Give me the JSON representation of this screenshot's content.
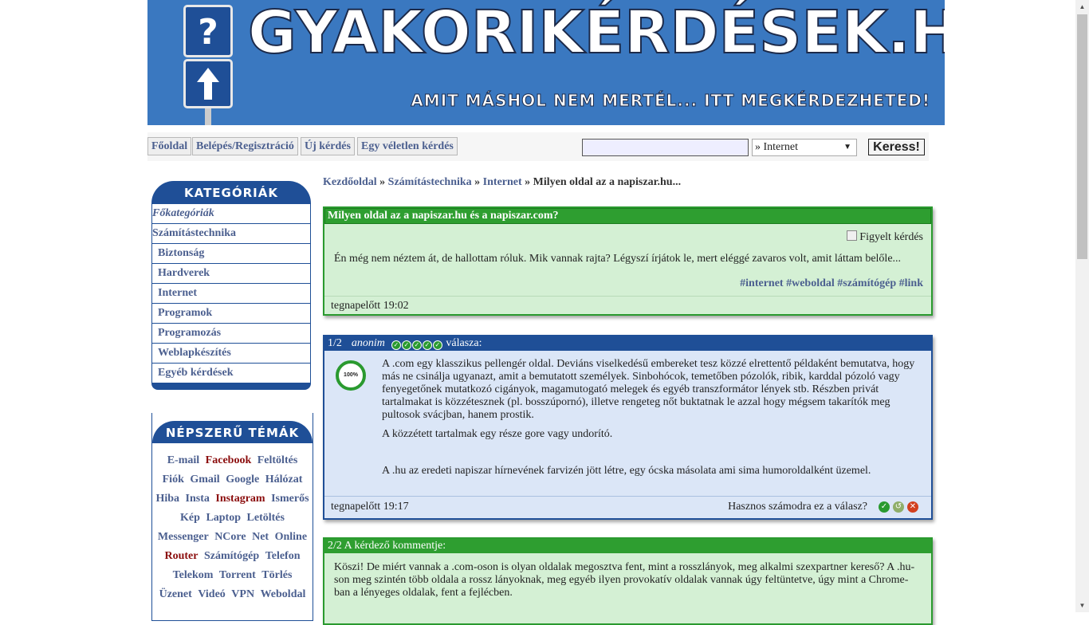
{
  "banner": {
    "title": "GYAKORIKÉRDÉSEK.HU",
    "slogan": "AMIT MÁSHOL NEM MERTÉL... ITT MEGKÉRDEZHETED!",
    "sign_question": "?",
    "sign_arrow": "↑"
  },
  "nav": {
    "home": "Főoldal",
    "login": "Belépés/Regisztráció",
    "new_question": "Új kérdés",
    "random_question": "Egy véletlen kérdés"
  },
  "search": {
    "placeholder": "",
    "category_selected": "» Internet",
    "button": "Keress!"
  },
  "categories": {
    "header": "KATEGÓRIÁK",
    "main_label": "Főkategóriák",
    "parent": "Számítástechnika",
    "items": [
      "Biztonság",
      "Hardverek",
      "Internet",
      "Programok",
      "Programozás",
      "Weblapkészítés",
      "Egyéb kérdések"
    ]
  },
  "popular": {
    "header": "NÉPSZERŰ TÉMÁK",
    "tags": [
      {
        "label": "E-mail",
        "hot": false
      },
      {
        "label": "Facebook",
        "hot": true
      },
      {
        "label": "Feltöltés",
        "hot": false
      },
      {
        "label": "Fiók",
        "hot": false
      },
      {
        "label": "Gmail",
        "hot": false
      },
      {
        "label": "Google",
        "hot": false
      },
      {
        "label": "Hálózat",
        "hot": false
      },
      {
        "label": "Hiba",
        "hot": false
      },
      {
        "label": "Insta",
        "hot": false
      },
      {
        "label": "Instagram",
        "hot": true
      },
      {
        "label": "Ismerős",
        "hot": false
      },
      {
        "label": "Kép",
        "hot": false
      },
      {
        "label": "Laptop",
        "hot": false
      },
      {
        "label": "Letöltés",
        "hot": false
      },
      {
        "label": "Messenger",
        "hot": false
      },
      {
        "label": "NCore",
        "hot": false
      },
      {
        "label": "Net",
        "hot": false
      },
      {
        "label": "Online",
        "hot": false
      },
      {
        "label": "Router",
        "hot": true
      },
      {
        "label": "Számítógép",
        "hot": false
      },
      {
        "label": "Telefon",
        "hot": false
      },
      {
        "label": "Telekom",
        "hot": false
      },
      {
        "label": "Torrent",
        "hot": false
      },
      {
        "label": "Törlés",
        "hot": false
      },
      {
        "label": "Üzenet",
        "hot": false
      },
      {
        "label": "Videó",
        "hot": false
      },
      {
        "label": "VPN",
        "hot": false
      },
      {
        "label": "Weboldal",
        "hot": false
      }
    ]
  },
  "breadcrumb": {
    "home": "Kezdőoldal",
    "sep": " » ",
    "level1": "Számítástechnika",
    "level2": "Internet",
    "current": "Milyen oldal az a napiszar.hu..."
  },
  "question": {
    "title": "Milyen oldal az a napiszar.hu és a napiszar.com?",
    "watch_label": "Figyelt kérdés",
    "body": "Én még nem néztem át, de hallottam róluk. Mik vannak rajta? Légyszí írjátok le, mert eléggé zavaros volt, amit láttam belőle...",
    "tags": "#internet #weboldal #számítógép #link",
    "time": "tegnapelőtt 19:02"
  },
  "answer1": {
    "index": "1/2",
    "user": "anonim",
    "suffix": "válasza:",
    "rating_percent": "100%",
    "paragraphs": [
      "A .com egy klasszikus pellengér oldal. Deviáns viselkedésű embereket tesz közzé elrettentő példaként bemutatva, hogy más ne csinálja ugyanazt, amit a bemutatott személyek. Sinbohócok, temetőben pózolók, ribik, karddal pózoló vagy fenyegetőnek mutatkozó cigányok, magamutogató melegek és egyéb transzformátor lények stb. Részben privát tartalmakat is közzétesznek (pl. bosszúpornó), illetve rengeteg nőt buktatnak le azzal hogy mégsem takarítók meg pultosok svácjban, hanem prostik.",
      "A közzétett tartalmak egy része gore vagy undorító.",
      "A .hu az eredeti napiszar hírnevének farvizén jött létre, egy ócska másolata ami sima humoroldalként üzemel."
    ],
    "time": "tegnapelőtt 19:17",
    "useful_question": "Hasznos számodra ez a válasz?"
  },
  "comment": {
    "header": "2/2 A kérdező kommentje:",
    "body": "Köszi! De miért vannak a .com-oson is olyan oldalak megosztva fent, mint a rosszlányok, meg alkalmi szexpartner kereső? A .hu-son meg szintén több oldala a rossz lányoknak, meg egyéb ilyen provokatív oldalak vannak úgy feltüntetve, úgy mint a Chrome-ban a lényeges oldalak, fent a fejlécben."
  },
  "colors": {
    "brand_blue": "#1f4f97",
    "banner_blue": "#3a78c0",
    "green": "#2e9e30",
    "link": "#4b5f8f",
    "hot_link": "#8b0d0d"
  }
}
